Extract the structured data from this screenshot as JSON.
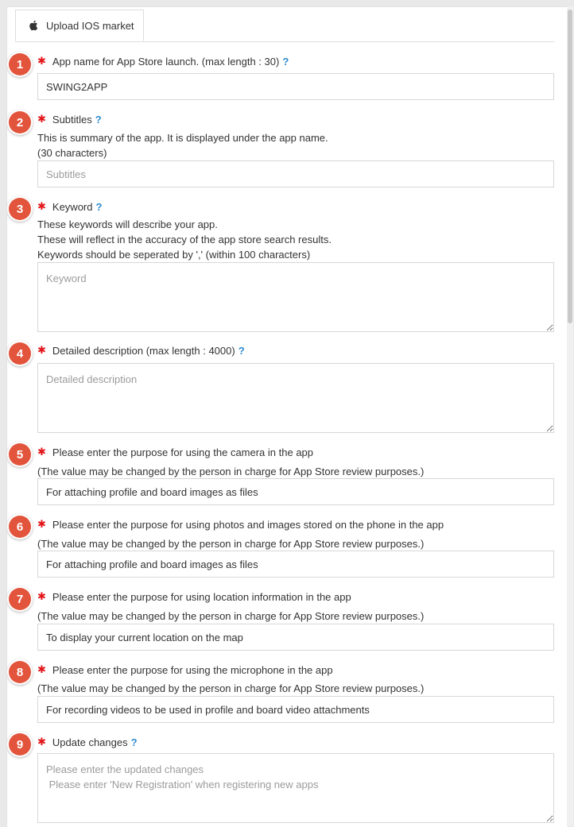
{
  "tab": {
    "label": "Upload IOS market"
  },
  "required_mark": "✱",
  "help_mark": "?",
  "fields": [
    {
      "number": "1",
      "label": "App name for App Store launch. (max length : 30)",
      "value": "SWING2APP",
      "placeholder": ""
    },
    {
      "number": "2",
      "label": "Subtitles",
      "desc_line1": "This is summary of the app. It is displayed under the app name.",
      "desc_line2": "(30 characters)",
      "value": "",
      "placeholder": "Subtitles"
    },
    {
      "number": "3",
      "label": "Keyword",
      "desc_line1": "These keywords will describe your app.",
      "desc_line2": "These will reflect in the accuracy of the app store search results.",
      "desc_line3": "Keywords should be seperated by ',' (within 100 characters)",
      "value": "",
      "placeholder": "Keyword"
    },
    {
      "number": "4",
      "label": "Detailed description (max length : 4000)",
      "value": "",
      "placeholder": "Detailed description"
    },
    {
      "number": "5",
      "label": "Please enter the purpose for using the camera in the app",
      "desc_line1": "(The value may be changed by the person in charge for App Store review purposes.)",
      "value": "For attaching profile and board images as files"
    },
    {
      "number": "6",
      "label": "Please enter the purpose for using photos and images stored on the phone in the app",
      "desc_line1": "(The value may be changed by the person in charge for App Store review purposes.)",
      "value": "For attaching profile and board images as files"
    },
    {
      "number": "7",
      "label": "Please enter the purpose for using location information in the app",
      "desc_line1": "(The value may be changed by the person in charge for App Store review purposes.)",
      "value": "To display your current location on the map"
    },
    {
      "number": "8",
      "label": "Please enter the purpose for using the microphone in the app",
      "desc_line1": "(The value may be changed by the person in charge for App Store review purposes.)",
      "value": "For recording videos to be used in profile and board video attachments"
    },
    {
      "number": "9",
      "label": "Update changes",
      "value": "",
      "placeholder": "Please enter the updated changes\n Please enter 'New Registration' when registering new apps"
    }
  ],
  "icons": {
    "tab": "apple-icon",
    "help": "help-icon",
    "required": "required-asterisk-icon"
  },
  "colors": {
    "badge": "#e2543b",
    "required": "#e3151a",
    "help": "#2f8bcf"
  }
}
